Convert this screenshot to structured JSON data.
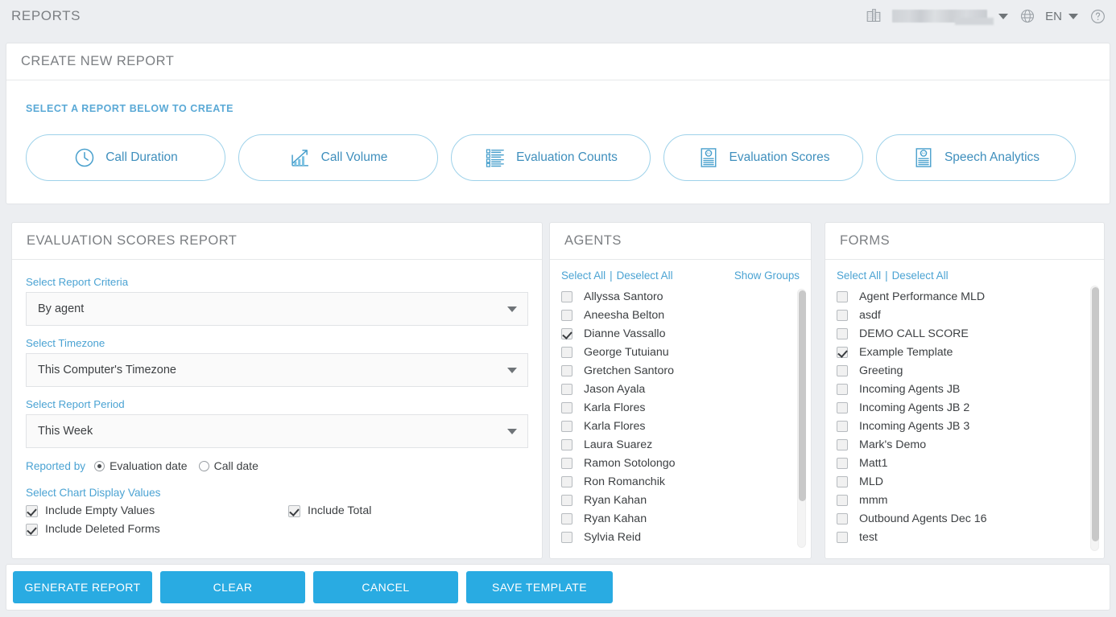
{
  "header": {
    "page_title": "REPORTS",
    "building_icon": "building-icon",
    "org_value": "",
    "globe_icon": "globe-icon",
    "language": "EN",
    "help_icon": "help-icon"
  },
  "create_panel": {
    "title": "CREATE NEW REPORT",
    "subtitle": "SELECT A REPORT BELOW TO CREATE",
    "report_types": [
      {
        "label": "Call Duration",
        "icon": "clock-icon"
      },
      {
        "label": "Call Volume",
        "icon": "bar-chart-icon"
      },
      {
        "label": "Evaluation Counts",
        "icon": "checklist-icon"
      },
      {
        "label": "Evaluation Scores",
        "icon": "score-document-icon"
      },
      {
        "label": "Speech Analytics",
        "icon": "score-document-icon"
      }
    ]
  },
  "report_form": {
    "title": "EVALUATION SCORES REPORT",
    "criteria": {
      "label": "Select Report Criteria",
      "value": "By agent"
    },
    "timezone": {
      "label": "Select Timezone",
      "value": "This Computer's Timezone"
    },
    "period": {
      "label": "Select Report Period",
      "value": "This Week"
    },
    "reported_by": {
      "label": "Reported by",
      "options": [
        {
          "label": "Evaluation date",
          "selected": true
        },
        {
          "label": "Call date",
          "selected": false
        }
      ]
    },
    "chart_values": {
      "label": "Select Chart Display Values",
      "options": [
        {
          "label": "Include Empty Values",
          "checked": true
        },
        {
          "label": "Include Deleted Forms",
          "checked": true
        },
        {
          "label": "Include Total",
          "checked": true
        }
      ]
    }
  },
  "agents_panel": {
    "title": "AGENTS",
    "select_all": "Select All",
    "separator": "|",
    "deselect_all": "Deselect All",
    "show_groups": "Show Groups",
    "items": [
      {
        "label": "Allyssa Santoro",
        "checked": false
      },
      {
        "label": "Aneesha Belton",
        "checked": false
      },
      {
        "label": "Dianne Vassallo",
        "checked": true
      },
      {
        "label": "George Tutuianu",
        "checked": false
      },
      {
        "label": "Gretchen Santoro",
        "checked": false
      },
      {
        "label": "Jason Ayala",
        "checked": false
      },
      {
        "label": "Karla Flores",
        "checked": false
      },
      {
        "label": "Karla Flores",
        "checked": false
      },
      {
        "label": "Laura Suarez",
        "checked": false
      },
      {
        "label": "Ramon Sotolongo",
        "checked": false
      },
      {
        "label": "Ron Romanchik",
        "checked": false
      },
      {
        "label": "Ryan Kahan",
        "checked": false
      },
      {
        "label": "Ryan Kahan",
        "checked": false
      },
      {
        "label": "Sylvia Reid",
        "checked": false
      }
    ]
  },
  "forms_panel": {
    "title": "FORMS",
    "select_all": "Select All",
    "separator": "|",
    "deselect_all": "Deselect All",
    "items": [
      {
        "label": "Agent Performance MLD",
        "checked": false
      },
      {
        "label": "asdf",
        "checked": false
      },
      {
        "label": "DEMO CALL SCORE",
        "checked": false
      },
      {
        "label": "Example Template",
        "checked": true
      },
      {
        "label": "Greeting",
        "checked": false
      },
      {
        "label": "Incoming Agents JB",
        "checked": false
      },
      {
        "label": "Incoming Agents JB 2",
        "checked": false
      },
      {
        "label": "Incoming Agents JB 3",
        "checked": false
      },
      {
        "label": "Mark's Demo",
        "checked": false
      },
      {
        "label": "Matt1",
        "checked": false
      },
      {
        "label": "MLD",
        "checked": false
      },
      {
        "label": "mmm",
        "checked": false
      },
      {
        "label": "Outbound Agents Dec 16",
        "checked": false
      },
      {
        "label": "test",
        "checked": false
      }
    ]
  },
  "actions": {
    "generate": "GENERATE REPORT",
    "clear": "CLEAR",
    "cancel": "CANCEL",
    "save_template": "SAVE TEMPLATE"
  },
  "colors": {
    "accent_blue": "#29abe2",
    "link_blue": "#4ba3d3",
    "outline_blue": "#9ed2ea",
    "page_bg": "#eceef1",
    "text_dark": "#3d4043",
    "heading_gray": "#7c7f83"
  }
}
